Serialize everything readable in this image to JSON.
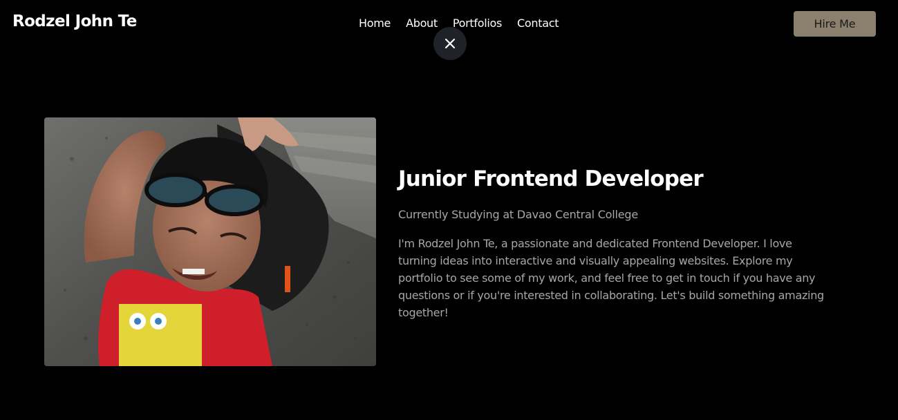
{
  "header": {
    "brand": "Rodzel John Te",
    "nav": [
      "Home",
      "About",
      "Portfolios",
      "Contact"
    ],
    "hire_label": "Hire Me",
    "close_icon": "close-icon"
  },
  "about": {
    "photo_alt": "Portrait photo",
    "title": "Junior Frontend Developer",
    "subtitle": "Currently Studying at Davao Central College",
    "bio": "I'm Rodzel John Te, a passionate and dedicated Frontend Developer. I love turning ideas into interactive and visually appealing websites. Explore my portfolio to see some of my work, and feel free to get in touch if you have any questions or if you're interested in collaborating. Let's build something amazing together!"
  },
  "colors": {
    "background": "#000000",
    "accent_button": "#8b7f6e",
    "muted_text": "#a7a7a7",
    "close_button_bg": "#1f2228"
  }
}
